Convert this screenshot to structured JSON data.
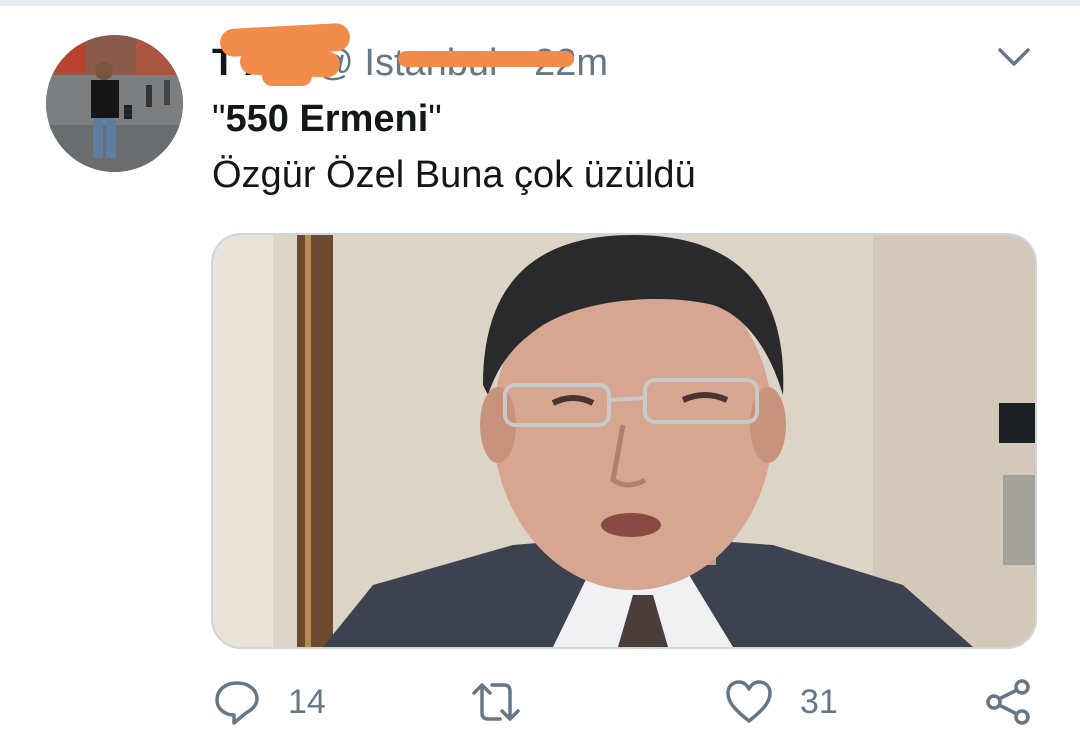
{
  "tweet": {
    "display_name": "T    AN",
    "handle": "@        Istanbul",
    "separator": "·",
    "time": "22m",
    "text_quote_open": "\"",
    "text_bold": "550 Ermeni",
    "text_quote_close": "\"",
    "text_line2": "Özgür Özel Buna çok üzüldü"
  },
  "actions": {
    "reply_count": "14",
    "like_count": "31"
  },
  "colors": {
    "text": "#14171a",
    "secondary": "#657786",
    "redaction": "#f28c4a",
    "border": "#ccd6dd"
  },
  "icons": [
    "chevron-down-icon",
    "reply-icon",
    "retweet-icon",
    "like-icon",
    "share-icon"
  ]
}
